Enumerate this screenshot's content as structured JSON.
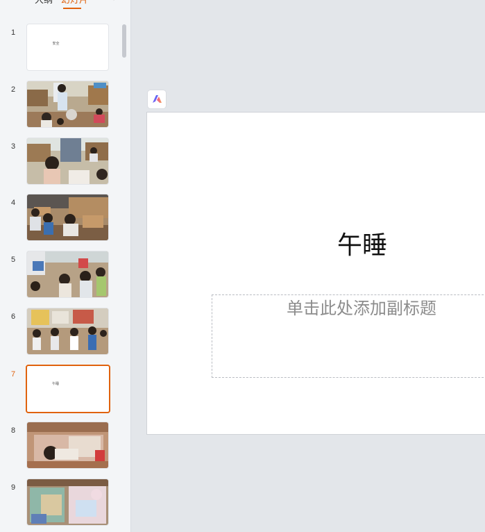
{
  "panel": {
    "tabs": [
      {
        "label": "大纲",
        "active": false
      },
      {
        "label": "幻灯片",
        "active": true
      }
    ],
    "collapse_icon": "chevron-left-icon",
    "slides": [
      {
        "number": "1",
        "type": "title",
        "title": "安全"
      },
      {
        "number": "2",
        "type": "photo"
      },
      {
        "number": "3",
        "type": "photo"
      },
      {
        "number": "4",
        "type": "photo"
      },
      {
        "number": "5",
        "type": "photo"
      },
      {
        "number": "6",
        "type": "photo"
      },
      {
        "number": "7",
        "type": "title",
        "title": "午睡",
        "active": true
      },
      {
        "number": "8",
        "type": "photo"
      },
      {
        "number": "9",
        "type": "photo"
      }
    ]
  },
  "editor": {
    "ai_icon": "ai-assistant-icon",
    "slide_title": "午睡",
    "subtitle_placeholder": "单击此处添加副标题"
  },
  "colors": {
    "accent": "#e0620d",
    "background": "#e3e6ea",
    "panel": "#f3f5f7"
  }
}
